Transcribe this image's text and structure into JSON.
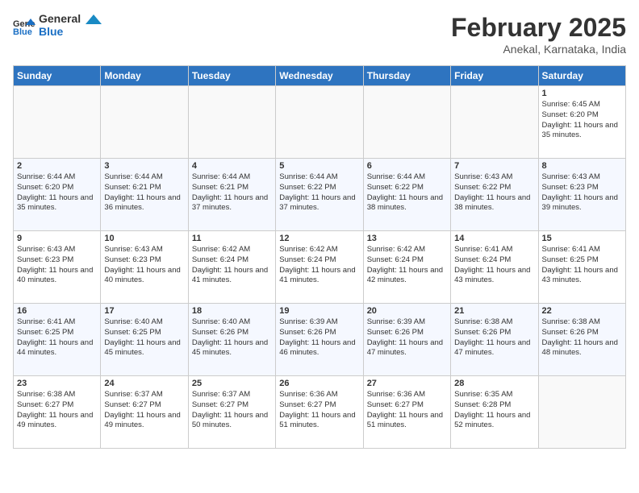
{
  "header": {
    "logo_general": "General",
    "logo_blue": "Blue",
    "title": "February 2025",
    "subtitle": "Anekal, Karnataka, India"
  },
  "days_of_week": [
    "Sunday",
    "Monday",
    "Tuesday",
    "Wednesday",
    "Thursday",
    "Friday",
    "Saturday"
  ],
  "weeks": [
    [
      {
        "day": "",
        "info": ""
      },
      {
        "day": "",
        "info": ""
      },
      {
        "day": "",
        "info": ""
      },
      {
        "day": "",
        "info": ""
      },
      {
        "day": "",
        "info": ""
      },
      {
        "day": "",
        "info": ""
      },
      {
        "day": "1",
        "info": "Sunrise: 6:45 AM\nSunset: 6:20 PM\nDaylight: 11 hours and 35 minutes."
      }
    ],
    [
      {
        "day": "2",
        "info": "Sunrise: 6:44 AM\nSunset: 6:20 PM\nDaylight: 11 hours and 35 minutes."
      },
      {
        "day": "3",
        "info": "Sunrise: 6:44 AM\nSunset: 6:21 PM\nDaylight: 11 hours and 36 minutes."
      },
      {
        "day": "4",
        "info": "Sunrise: 6:44 AM\nSunset: 6:21 PM\nDaylight: 11 hours and 37 minutes."
      },
      {
        "day": "5",
        "info": "Sunrise: 6:44 AM\nSunset: 6:22 PM\nDaylight: 11 hours and 37 minutes."
      },
      {
        "day": "6",
        "info": "Sunrise: 6:44 AM\nSunset: 6:22 PM\nDaylight: 11 hours and 38 minutes."
      },
      {
        "day": "7",
        "info": "Sunrise: 6:43 AM\nSunset: 6:22 PM\nDaylight: 11 hours and 38 minutes."
      },
      {
        "day": "8",
        "info": "Sunrise: 6:43 AM\nSunset: 6:23 PM\nDaylight: 11 hours and 39 minutes."
      }
    ],
    [
      {
        "day": "9",
        "info": "Sunrise: 6:43 AM\nSunset: 6:23 PM\nDaylight: 11 hours and 40 minutes."
      },
      {
        "day": "10",
        "info": "Sunrise: 6:43 AM\nSunset: 6:23 PM\nDaylight: 11 hours and 40 minutes."
      },
      {
        "day": "11",
        "info": "Sunrise: 6:42 AM\nSunset: 6:24 PM\nDaylight: 11 hours and 41 minutes."
      },
      {
        "day": "12",
        "info": "Sunrise: 6:42 AM\nSunset: 6:24 PM\nDaylight: 11 hours and 41 minutes."
      },
      {
        "day": "13",
        "info": "Sunrise: 6:42 AM\nSunset: 6:24 PM\nDaylight: 11 hours and 42 minutes."
      },
      {
        "day": "14",
        "info": "Sunrise: 6:41 AM\nSunset: 6:24 PM\nDaylight: 11 hours and 43 minutes."
      },
      {
        "day": "15",
        "info": "Sunrise: 6:41 AM\nSunset: 6:25 PM\nDaylight: 11 hours and 43 minutes."
      }
    ],
    [
      {
        "day": "16",
        "info": "Sunrise: 6:41 AM\nSunset: 6:25 PM\nDaylight: 11 hours and 44 minutes."
      },
      {
        "day": "17",
        "info": "Sunrise: 6:40 AM\nSunset: 6:25 PM\nDaylight: 11 hours and 45 minutes."
      },
      {
        "day": "18",
        "info": "Sunrise: 6:40 AM\nSunset: 6:26 PM\nDaylight: 11 hours and 45 minutes."
      },
      {
        "day": "19",
        "info": "Sunrise: 6:39 AM\nSunset: 6:26 PM\nDaylight: 11 hours and 46 minutes."
      },
      {
        "day": "20",
        "info": "Sunrise: 6:39 AM\nSunset: 6:26 PM\nDaylight: 11 hours and 47 minutes."
      },
      {
        "day": "21",
        "info": "Sunrise: 6:38 AM\nSunset: 6:26 PM\nDaylight: 11 hours and 47 minutes."
      },
      {
        "day": "22",
        "info": "Sunrise: 6:38 AM\nSunset: 6:26 PM\nDaylight: 11 hours and 48 minutes."
      }
    ],
    [
      {
        "day": "23",
        "info": "Sunrise: 6:38 AM\nSunset: 6:27 PM\nDaylight: 11 hours and 49 minutes."
      },
      {
        "day": "24",
        "info": "Sunrise: 6:37 AM\nSunset: 6:27 PM\nDaylight: 11 hours and 49 minutes."
      },
      {
        "day": "25",
        "info": "Sunrise: 6:37 AM\nSunset: 6:27 PM\nDaylight: 11 hours and 50 minutes."
      },
      {
        "day": "26",
        "info": "Sunrise: 6:36 AM\nSunset: 6:27 PM\nDaylight: 11 hours and 51 minutes."
      },
      {
        "day": "27",
        "info": "Sunrise: 6:36 AM\nSunset: 6:27 PM\nDaylight: 11 hours and 51 minutes."
      },
      {
        "day": "28",
        "info": "Sunrise: 6:35 AM\nSunset: 6:28 PM\nDaylight: 11 hours and 52 minutes."
      },
      {
        "day": "",
        "info": ""
      }
    ]
  ]
}
